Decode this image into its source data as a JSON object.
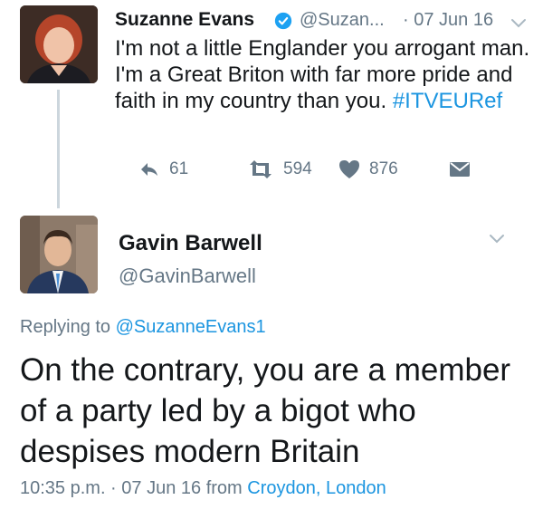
{
  "tweet1": {
    "name": "Suzanne Evans",
    "handle": "@Suzan...",
    "date": "· 07 Jun 16",
    "text": "I'm not a little Englander you arrogant man. I'm a Great Briton with far more pride and faith in my country than you.",
    "hashtag": "#ITVEURef",
    "reply_count": "61",
    "retweet_count": "594",
    "like_count": "876",
    "verified": true,
    "icons": [
      "reply-icon",
      "retweet-icon",
      "heart-icon",
      "dm-icon",
      "chevron-down-icon",
      "verified-icon"
    ]
  },
  "tweet2": {
    "name": "Gavin Barwell",
    "handle": "@GavinBarwell",
    "replying_prefix": "Replying to",
    "replying_to": "@SuzanneEvans1",
    "text": "On the contrary, you are a member of a party led by a bigot who despises modern Britain",
    "time": "10:35 p.m. · 07 Jun 16",
    "from_prefix": "from",
    "location": "Croydon, London"
  },
  "colors": {
    "accent": "#1b95e0",
    "secondary_text": "#657786",
    "primary_text": "#14171a",
    "verified": "#1da1f2",
    "thread_line": "#ccd6dd"
  }
}
